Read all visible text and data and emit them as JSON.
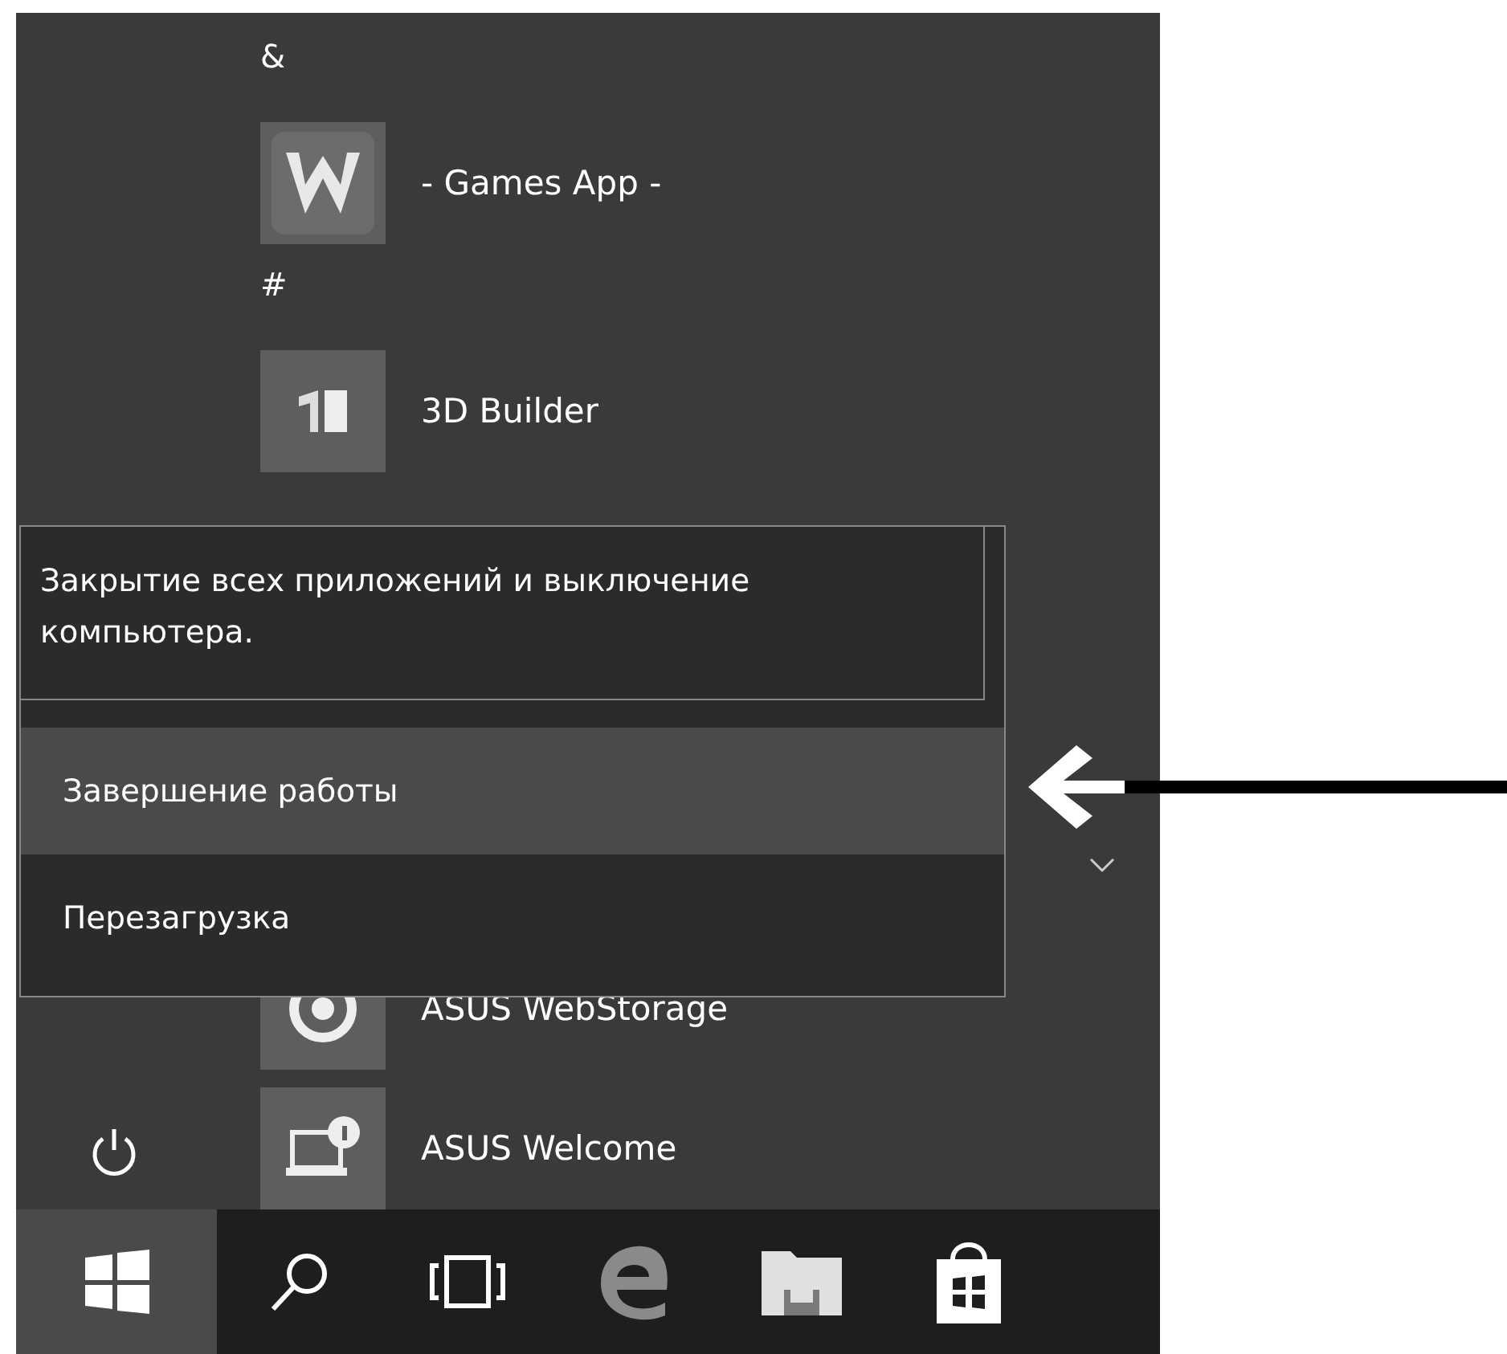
{
  "app_list": [
    {
      "kind": "header",
      "label": "&"
    },
    {
      "kind": "app",
      "label": "- Games App -"
    },
    {
      "kind": "header",
      "label": "#"
    },
    {
      "kind": "app",
      "label": "3D Builder"
    }
  ],
  "app_list_bottom": [
    {
      "kind": "app",
      "label": "ASUS WebStorage"
    },
    {
      "kind": "app",
      "label": "ASUS Welcome"
    }
  ],
  "power_menu": {
    "tooltip": "Закрытие всех приложений и выключение компьютера.",
    "items": [
      {
        "label": "Завершение работы",
        "selected": true
      },
      {
        "label": "Перезагрузка",
        "selected": false
      }
    ]
  },
  "taskbar": [
    {
      "selected": true
    },
    {
      "selected": false
    },
    {
      "selected": false
    },
    {
      "selected": false
    },
    {
      "selected": false
    },
    {
      "selected": false
    }
  ]
}
